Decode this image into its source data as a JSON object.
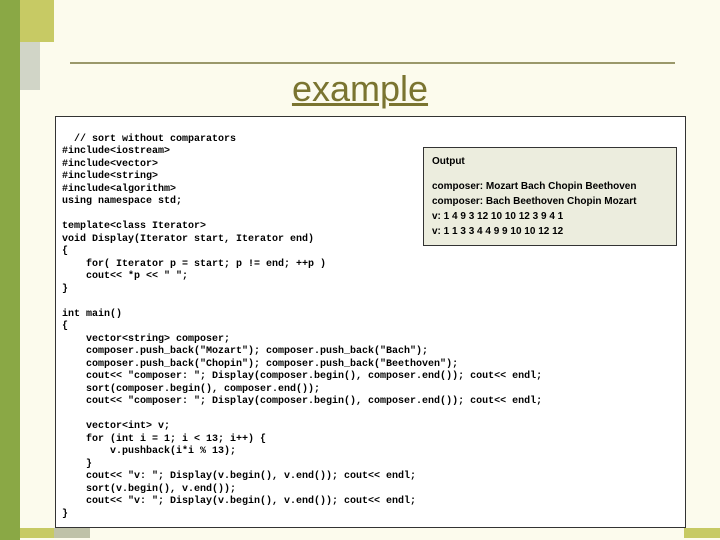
{
  "title": "example",
  "code": "// sort without comparators\n#include<iostream>\n#include<vector>\n#include<string>\n#include<algorithm>\nusing namespace std;\n\ntemplate<class Iterator>\nvoid Display(Iterator start, Iterator end)\n{\n    for( Iterator p = start; p != end; ++p )\n    cout<< *p << \" \";\n}\n\nint main()\n{\n    vector<string> composer;\n    composer.push_back(\"Mozart\"); composer.push_back(\"Bach\");\n    composer.push_back(\"Chopin\"); composer.push_back(\"Beethoven\");\n    cout<< \"composer: \"; Display(composer.begin(), composer.end()); cout<< endl;\n    sort(composer.begin(), composer.end());\n    cout<< \"composer: \"; Display(composer.begin(), composer.end()); cout<< endl;\n\n    vector<int> v;\n    for (int i = 1; i < 13; i++) {\n        v.pushback(i*i % 13);\n    }\n    cout<< \"v: \"; Display(v.begin(), v.end()); cout<< endl;\n    sort(v.begin(), v.end());\n    cout<< \"v: \"; Display(v.begin(), v.end()); cout<< endl;\n}",
  "output": {
    "title": "Output",
    "lines": [
      "composer: Mozart Bach Chopin Beethoven",
      "composer: Bach Beethoven Chopin Mozart",
      "v: 1 4 9 3 12 10 10 12 3 9 4 1",
      "v: 1 1 3 3 4 4 9 9 10 10 12 12"
    ]
  }
}
